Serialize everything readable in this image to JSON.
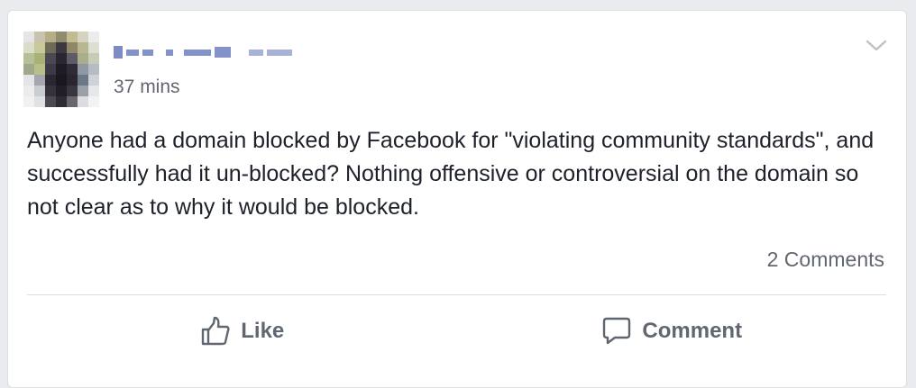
{
  "post": {
    "author_name": "",
    "timestamp": "37 mins",
    "text": "Anyone had a domain blocked by Facebook for \"violating community standards\", and successfully had it un-blocked? Nothing offensive or controversial on the domain so not clear as to why it would be blocked.",
    "comments_count": "2 Comments"
  },
  "actions": {
    "like_label": "Like",
    "comment_label": "Comment"
  },
  "icons": {
    "like": "thumbs-up-icon",
    "comment": "speech-bubble-icon",
    "menu": "chevron-down-icon"
  },
  "colors": {
    "background": "#e9ebee",
    "card": "#ffffff",
    "text": "#1d2129",
    "secondary_text": "#616770",
    "action_text": "#606770",
    "divider": "#dadde1"
  }
}
